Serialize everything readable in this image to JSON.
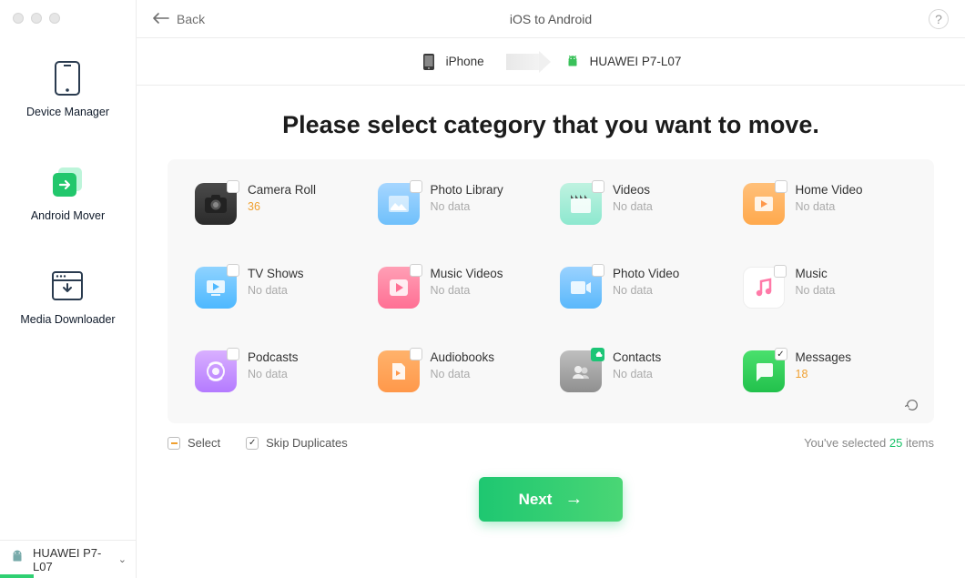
{
  "header": {
    "back_label": "Back",
    "title": "iOS to Android",
    "help_label": "?"
  },
  "devices": {
    "source_name": "iPhone",
    "target_name": "HUAWEI P7-L07"
  },
  "sidebar": {
    "items": [
      {
        "label": "Device Manager"
      },
      {
        "label": "Android Mover"
      },
      {
        "label": "Media Downloader"
      }
    ],
    "connected_device": "HUAWEI P7-L07"
  },
  "main": {
    "title": "Please select category that you want to move.",
    "categories": [
      {
        "title": "Camera Roll",
        "sub": "36",
        "accent": true,
        "checked": false
      },
      {
        "title": "Photo Library",
        "sub": "No data",
        "accent": false,
        "checked": false
      },
      {
        "title": "Videos",
        "sub": "No data",
        "accent": false,
        "checked": false
      },
      {
        "title": "Home Video",
        "sub": "No data",
        "accent": false,
        "checked": false
      },
      {
        "title": "TV Shows",
        "sub": "No data",
        "accent": false,
        "checked": false
      },
      {
        "title": "Music Videos",
        "sub": "No data",
        "accent": false,
        "checked": false
      },
      {
        "title": "Photo Video",
        "sub": "No data",
        "accent": false,
        "checked": false
      },
      {
        "title": "Music",
        "sub": "No data",
        "accent": false,
        "checked": false
      },
      {
        "title": "Podcasts",
        "sub": "No data",
        "accent": false,
        "checked": false
      },
      {
        "title": "Audiobooks",
        "sub": "No data",
        "accent": false,
        "checked": false
      },
      {
        "title": "Contacts",
        "sub": "No data",
        "accent": false,
        "checked": false,
        "cloud": true
      },
      {
        "title": "Messages",
        "sub": "18",
        "accent": true,
        "checked": true
      }
    ],
    "select_label": "Select",
    "skip_label": "Skip Duplicates",
    "selected_prefix": "You've selected ",
    "selected_count": "25",
    "selected_suffix": " items",
    "next_label": "Next"
  }
}
